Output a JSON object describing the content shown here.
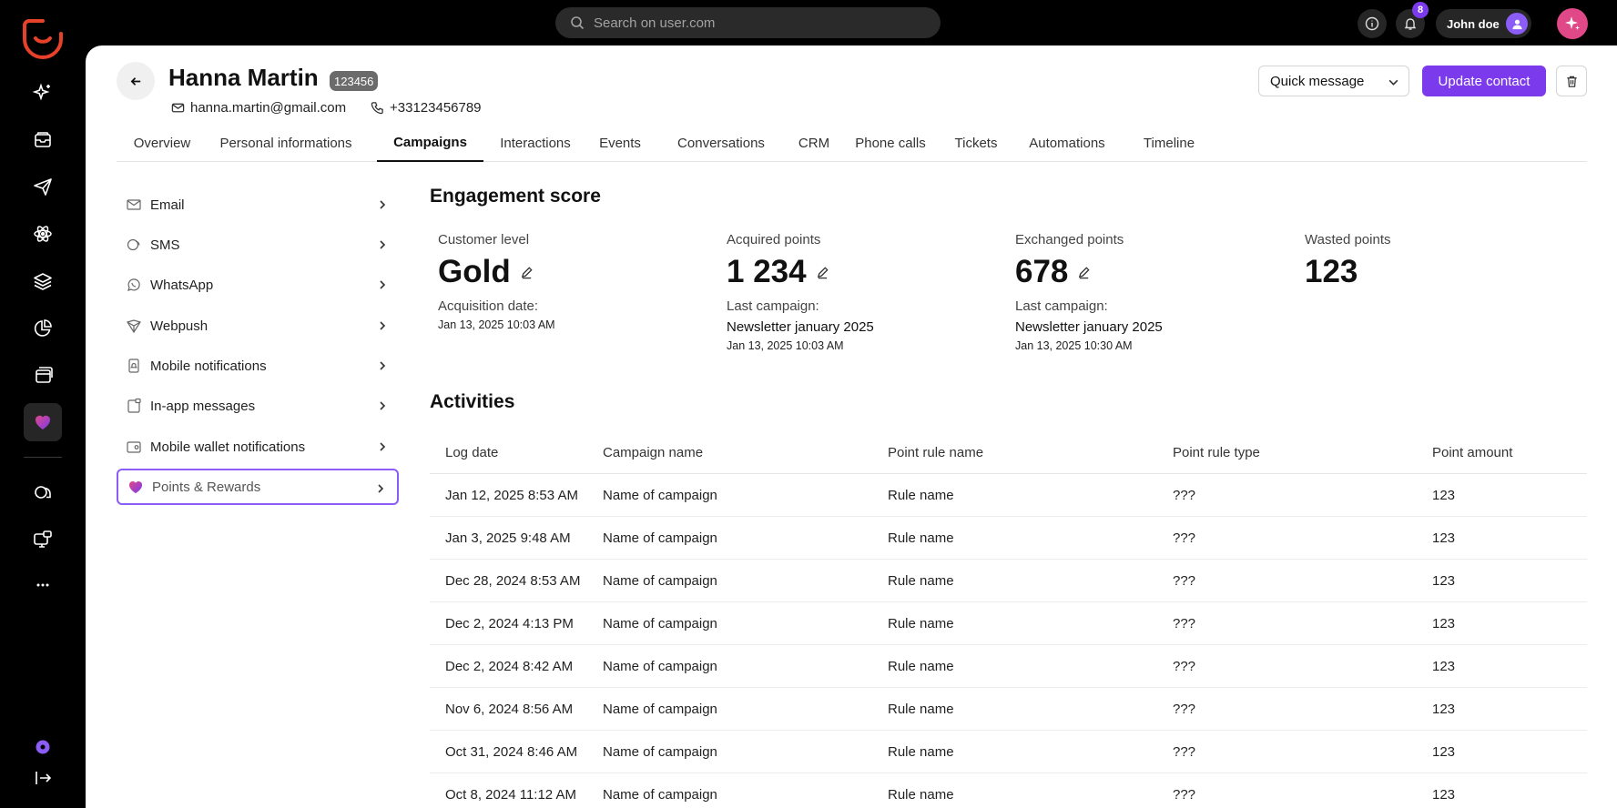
{
  "search": {
    "placeholder": "Search on user.com"
  },
  "topbar": {
    "notification_count": "8",
    "user_name": "John doe"
  },
  "contact": {
    "name": "Hanna Martin",
    "id": "123456",
    "email": "hanna.martin@gmail.com",
    "phone": "+33123456789"
  },
  "actions": {
    "quick_message": "Quick message",
    "update_contact": "Update contact"
  },
  "tabs": [
    {
      "label": "Overview"
    },
    {
      "label": "Personal informations"
    },
    {
      "label": "Campaigns"
    },
    {
      "label": "Interactions"
    },
    {
      "label": "Events"
    },
    {
      "label": "Conversations"
    },
    {
      "label": "CRM"
    },
    {
      "label": "Phone calls"
    },
    {
      "label": "Tickets"
    },
    {
      "label": "Automations"
    },
    {
      "label": "Timeline"
    }
  ],
  "channels": [
    {
      "label": "Email"
    },
    {
      "label": "SMS"
    },
    {
      "label": "WhatsApp"
    },
    {
      "label": "Webpush"
    },
    {
      "label": "Mobile notifications"
    },
    {
      "label": "In-app messages"
    },
    {
      "label": "Mobile wallet notifications"
    },
    {
      "label": "Points & Rewards"
    }
  ],
  "engagement": {
    "title": "Engagement score",
    "customer_level": {
      "label": "Customer level",
      "value": "Gold",
      "sub_label": "Acquisition date:",
      "date": "Jan 13, 2025 10:03 AM"
    },
    "acquired": {
      "label": "Acquired points",
      "value": "1 234",
      "sub_label": "Last campaign:",
      "campaign": "Newsletter january 2025",
      "date": "Jan 13, 2025 10:03 AM"
    },
    "exchanged": {
      "label": "Exchanged points",
      "value": "678",
      "sub_label": "Last campaign:",
      "campaign": "Newsletter january 2025",
      "date": "Jan 13, 2025 10:30 AM"
    },
    "wasted": {
      "label": "Wasted points",
      "value": "123"
    }
  },
  "activities": {
    "title": "Activities",
    "columns": [
      "Log date",
      "Campaign name",
      "Point rule name",
      "Point rule type",
      "Point amount"
    ],
    "rows": [
      [
        "Jan 12, 2025 8:53 AM",
        "Name of campaign",
        "Rule name",
        "???",
        "123"
      ],
      [
        "Jan 3, 2025 9:48 AM",
        "Name of campaign",
        "Rule name",
        "???",
        "123"
      ],
      [
        "Dec 28, 2024 8:53 AM",
        "Name of campaign",
        "Rule name",
        "???",
        "123"
      ],
      [
        "Dec 2, 2024 4:13 PM",
        "Name of campaign",
        "Rule name",
        "???",
        "123"
      ],
      [
        "Dec 2, 2024 8:42 AM",
        "Name of campaign",
        "Rule name",
        "???",
        "123"
      ],
      [
        "Nov 6, 2024 8:56 AM",
        "Name of campaign",
        "Rule name",
        "???",
        "123"
      ],
      [
        "Oct 31, 2024 8:46 AM",
        "Name of campaign",
        "Rule name",
        "???",
        "123"
      ],
      [
        "Oct 8, 2024 11:12 AM",
        "Name of campaign",
        "Rule name",
        "???",
        "123"
      ]
    ]
  },
  "colors": {
    "accent": "#7c3aed",
    "brand": "#e8412a",
    "pink": "#e04888"
  }
}
